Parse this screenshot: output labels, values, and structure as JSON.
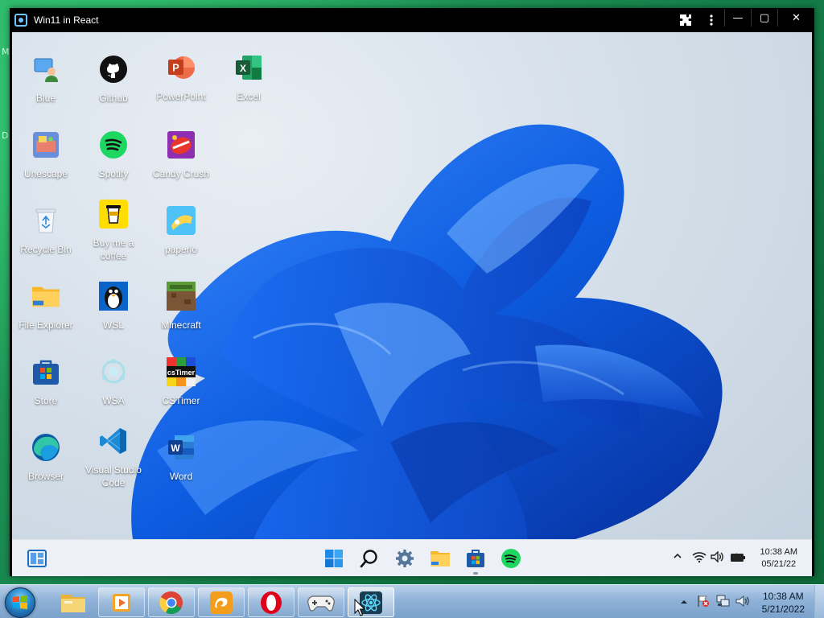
{
  "window": {
    "title": "Win11 in React",
    "extensions_icon": "puzzle-icon",
    "menu_icon": "kebab-menu-icon",
    "minimize": "—",
    "maximize": "▢",
    "close": "✕"
  },
  "edge_letters": [
    "M",
    "D"
  ],
  "desktop_icons": [
    {
      "label": "Blue",
      "icon": "blue-user-icon"
    },
    {
      "label": "Github",
      "icon": "github-icon"
    },
    {
      "label": "PowerPoint",
      "icon": "powerpoint-icon"
    },
    {
      "label": "Excel",
      "icon": "excel-icon"
    },
    {
      "label": "Unescape",
      "icon": "unescape-icon"
    },
    {
      "label": "Spotify",
      "icon": "spotify-icon"
    },
    {
      "label": "Candy Crush",
      "icon": "candy-crush-icon"
    },
    {
      "label": "Recycle Bin",
      "icon": "recycle-bin-icon"
    },
    {
      "label": "Buy me a coffee",
      "icon": "coffee-icon"
    },
    {
      "label": "paperio",
      "icon": "paperio-icon"
    },
    {
      "label": "File Explorer",
      "icon": "folder-icon"
    },
    {
      "label": "WSL",
      "icon": "tux-icon"
    },
    {
      "label": "Minecraft",
      "icon": "minecraft-icon"
    },
    {
      "label": "Store",
      "icon": "store-icon"
    },
    {
      "label": "WSA",
      "icon": "android-icon"
    },
    {
      "label": "CSTimer",
      "icon": "cstimer-icon"
    },
    {
      "label": "Browser",
      "icon": "edge-icon"
    },
    {
      "label": "Visual Studio Code",
      "icon": "vscode-icon"
    },
    {
      "label": "Word",
      "icon": "word-icon"
    }
  ],
  "w11_taskbar": {
    "widgets_icon": "widgets-icon",
    "center_apps": [
      "start-icon",
      "search-icon",
      "settings-icon",
      "file-explorer-icon",
      "store-icon",
      "spotify-icon"
    ],
    "tray": [
      "chevron-up-icon",
      "wifi-icon",
      "volume-icon",
      "battery-icon"
    ],
    "time": "10:38 AM",
    "date": "05/21/22"
  },
  "win7_taskbar": {
    "pinned": [
      "explorer-icon",
      "media-player-icon",
      "chrome-icon",
      "uc-browser-icon",
      "opera-icon",
      "gamepad-icon",
      "react-app-icon"
    ],
    "time": "10:38 AM",
    "date": "5/21/2022",
    "tray": [
      "show-hidden-icons-icon",
      "action-center-flag-icon",
      "network-icon",
      "volume-icon"
    ]
  },
  "colors": {
    "accent": "#0078d4",
    "wallpaper_blue": "#1565e8",
    "win7_bar": "#8fb2d8"
  }
}
